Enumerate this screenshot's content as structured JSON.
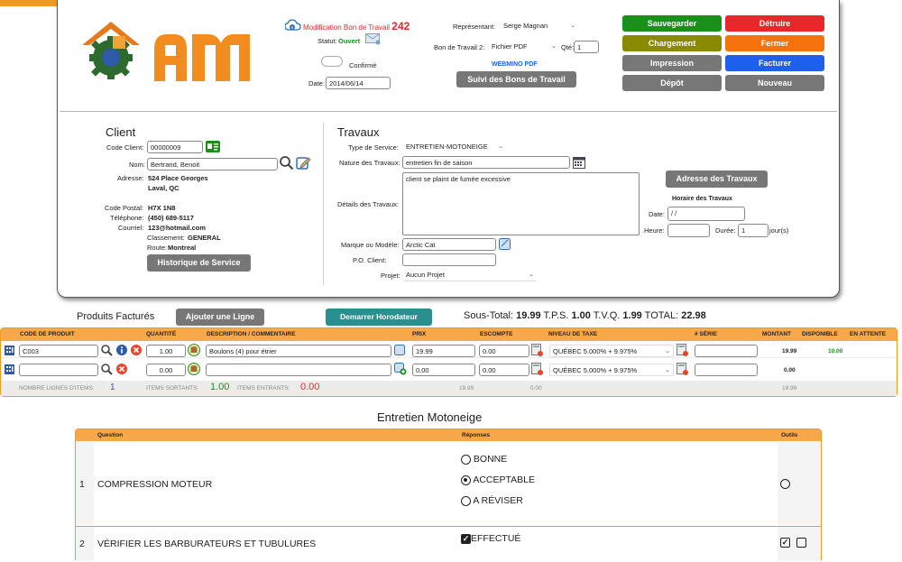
{
  "header": {
    "title_prefix": "Modification Bon de Travail",
    "number": "242",
    "statut_label": "Statut:",
    "statut_value": "Ouvert",
    "confirme_label": "Confirmé",
    "date_label": "Date:",
    "date_value": "2014/06/14",
    "representant_label": "Représentant:",
    "representant_value": "Serge Magnan",
    "bon_label": "Bon de Travail 2:",
    "bon_value": "Fichier PDF",
    "qte_label": "Qté:",
    "qte_value": "1",
    "webmino_label": "WEBMINO PDF",
    "suivi_label": "Suivi des Bons de Travail"
  },
  "action_buttons": [
    {
      "label": "Sauvegarder",
      "color": "#1a8f1a"
    },
    {
      "label": "Détruire",
      "color": "#e8262b"
    },
    {
      "label": "Chargement",
      "color": "#8a8a00"
    },
    {
      "label": "Fermer",
      "color": "#f5730f"
    },
    {
      "label": "Impression",
      "color": "#777777"
    },
    {
      "label": "Facturer",
      "color": "#1f5ff0"
    },
    {
      "label": "Dépôt",
      "color": "#777777"
    },
    {
      "label": "Nouveau",
      "color": "#777777"
    }
  ],
  "client": {
    "title": "Client",
    "code_label": "Code Client:",
    "code_value": "00000009",
    "nom_label": "Nom:",
    "nom_value": "Bertrand, Benoit",
    "adresse_label": "Adresse:",
    "adresse_line1": "524 Place Georges",
    "adresse_line2": "Laval, QC",
    "postal_label": "Code Postal:",
    "postal_value": "H7X 1N8",
    "tel_label": "Téléphone:",
    "tel_value": "(450) 689-5117",
    "courriel_label": "Courriel:",
    "courriel_value": "123@hotmail.com",
    "classement_label": "Classement:",
    "classement_value": "GENERAL",
    "route_label": "Route:",
    "route_value": "Montreal",
    "historique_label": "Historique de Service"
  },
  "travaux": {
    "title": "Travaux",
    "type_label": "Type de Service:",
    "type_value": "ENTRETIEN-MOTONEIGE",
    "nature_label": "Nature des Travaux:",
    "nature_value": "entretien fin de saison",
    "details_label": "Détails des Travaux:",
    "details_value": "client se plaint de fumée excessive",
    "marque_label": "Marque ou Modèle:",
    "marque_value": "Arctic Cat",
    "po_label": "P.O. Client:",
    "po_value": "",
    "projet_label": "Projet:",
    "projet_value": "Aucun Projet",
    "adresse_btn": "Adresse des Travaux",
    "horaire_title": "Horaire des Travaux",
    "date_label": "Date:",
    "date_value": "  /  /",
    "heure_label": "Heure:",
    "duree_label": "Durée:",
    "duree_value": "1",
    "jours_label": "jour(s)"
  },
  "products": {
    "title": "Produits Facturés",
    "add_line": "Ajouter une Ligne",
    "horodateur": "Demarrer Horodateur",
    "totals_prefix": "Sous-Total:",
    "sous_total": "19.99",
    "tps_label": "T.P.S.",
    "tps": "1.00",
    "tvq_label": "T.V.Q.",
    "tvq": "1.99",
    "total_label": "TOTAL:",
    "total": "22.98",
    "headers": [
      "CODE DE PRODUIT",
      "QUANTITÉ",
      "DESCRIPTION / COMMENTAIRE",
      "PRIX",
      "ESCOMPTE",
      "NIVEAU DE TAXE",
      "# SÉRIE",
      "MONTANT",
      "DISPONIBLE",
      "EN ATTENTE"
    ],
    "rows": [
      {
        "code": "C003",
        "qty": "1.00",
        "desc": "Boulons (4) pour étrier",
        "prix": "19.99",
        "escompte": "0.00",
        "taxe": "QUÉBEC 5.000% + 9.975%",
        "serie": "",
        "montant": "19.99",
        "disponible": "10.00",
        "attente": ""
      },
      {
        "code": "",
        "qty": "0.00",
        "desc": "",
        "prix": "0.00",
        "escompte": "0.00",
        "taxe": "QUÉBEC 5.000% + 9.975%",
        "serie": "",
        "montant": "0.00",
        "disponible": "",
        "attente": ""
      }
    ],
    "footer": {
      "nb_label": "NOMBRE LIGNES D'ITEMS:",
      "nb_value": "1",
      "sortants_label": "ITEMS SORTANTS:",
      "sortants_value": "1.00",
      "entrants_label": "ITEMS ENTRANTS:",
      "entrants_value": "0.00",
      "prix_total": "19.99",
      "escompte_total": "0.00",
      "montant_total": "19.99"
    }
  },
  "questionnaire": {
    "title": "Entretien Motoneige",
    "headers": {
      "question": "Question",
      "reponses": "Réponses",
      "outils": "Outils"
    },
    "items": [
      {
        "num": "1",
        "text": "COMPRESSION MOTEUR",
        "options": [
          "BONNE",
          "ACCEPTABLE",
          "A RÉVISER"
        ],
        "selected": 1
      },
      {
        "num": "2",
        "text": "VÉRIFIER LES BARBURATEURS ET TUBULURES",
        "options": [
          "EFFECTUÉ"
        ],
        "checked": true
      }
    ]
  }
}
